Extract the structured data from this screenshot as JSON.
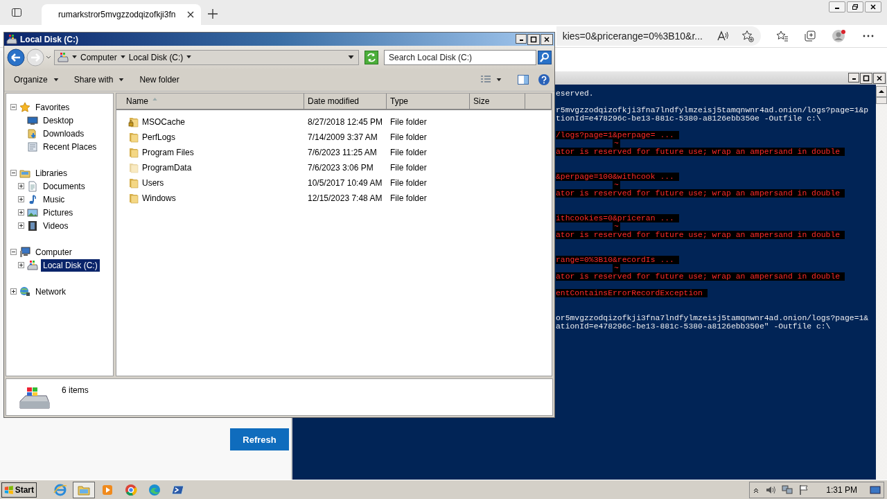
{
  "browser": {
    "tab_title": "rumarkstror5mvgzzodqizofkji3fn",
    "address": "kies=0&pricerange=0%3B10&r...",
    "page_button": "Refresh"
  },
  "console": {
    "lines": [
      {
        "kind": "output",
        "text": "eserved."
      },
      {
        "kind": "blank"
      },
      {
        "kind": "output",
        "text": "r5mvgzzodqizofkji3fna7lndfylmzeisj5tamqnwnr4ad.onion/logs?page=1&p"
      },
      {
        "kind": "output",
        "text": "tionId=e478296c-be13-881c-5380-a8126ebb350e -Outfile c:\\"
      },
      {
        "kind": "blank"
      },
      {
        "kind": "error",
        "text": "/logs?page=1&perpage= ..."
      },
      {
        "kind": "marker",
        "text": "~"
      },
      {
        "kind": "error",
        "text": "ator is reserved for future use; wrap an ampersand in double"
      },
      {
        "kind": "blank"
      },
      {
        "kind": "blank"
      },
      {
        "kind": "error",
        "text": "&perpage=100&withcook ..."
      },
      {
        "kind": "marker",
        "text": "~"
      },
      {
        "kind": "error",
        "text": "ator is reserved for future use; wrap an ampersand in double"
      },
      {
        "kind": "blank"
      },
      {
        "kind": "blank"
      },
      {
        "kind": "error",
        "text": "ithcookies=0&priceran ..."
      },
      {
        "kind": "marker",
        "text": "~"
      },
      {
        "kind": "error",
        "text": "ator is reserved for future use; wrap an ampersand in double"
      },
      {
        "kind": "blank"
      },
      {
        "kind": "blank"
      },
      {
        "kind": "error",
        "text": "range=0%3B10&recordIs ..."
      },
      {
        "kind": "marker",
        "text": "~"
      },
      {
        "kind": "error",
        "text": "ator is reserved for future use; wrap an ampersand in double"
      },
      {
        "kind": "blank"
      },
      {
        "kind": "error",
        "text": "entContainsErrorRecordException"
      },
      {
        "kind": "blank"
      },
      {
        "kind": "blank"
      },
      {
        "kind": "output",
        "text": "or5mvgzzodqizofkji3fna7lndfylmzeisj5tamqnwnr4ad.onion/logs?page=1&"
      },
      {
        "kind": "output",
        "text": "ationId=e478296c-be13-881c-5380-a8126ebb350e\" -Outfile c:\\"
      }
    ]
  },
  "explorer": {
    "title": "Local Disk (C:)",
    "breadcrumbs": [
      "Computer",
      "Local Disk (C:)"
    ],
    "search": {
      "placeholder": "Search Local Disk (C:)"
    },
    "toolbar": [
      {
        "label": "Organize",
        "menu": true
      },
      {
        "label": "Share with",
        "menu": true
      },
      {
        "label": "New folder",
        "menu": false
      }
    ],
    "tree": [
      {
        "label": "Favorites",
        "kind": "star",
        "expanded": true,
        "selected": false,
        "children": [
          {
            "label": "Desktop",
            "kind": "desktop",
            "selected": false
          },
          {
            "label": "Downloads",
            "kind": "downloads",
            "selected": false
          },
          {
            "label": "Recent Places",
            "kind": "recent",
            "selected": false
          }
        ]
      },
      {
        "label": "Libraries",
        "kind": "library",
        "expanded": true,
        "selected": false,
        "children": [
          {
            "label": "Documents",
            "kind": "document",
            "expanded": false,
            "selected": false
          },
          {
            "label": "Music",
            "kind": "music",
            "expanded": false,
            "selected": false
          },
          {
            "label": "Pictures",
            "kind": "pictures",
            "expanded": false,
            "selected": false
          },
          {
            "label": "Videos",
            "kind": "videos",
            "expanded": false,
            "selected": false
          }
        ]
      },
      {
        "label": "Computer",
        "kind": "computer",
        "expanded": true,
        "selected": false,
        "children": [
          {
            "label": "Local Disk (C:)",
            "kind": "drive",
            "expanded": false,
            "selected": true
          }
        ]
      },
      {
        "label": "Network",
        "kind": "network",
        "expanded": false,
        "selected": false
      }
    ],
    "columns": [
      {
        "label": "Name",
        "sorted": true
      },
      {
        "label": "Date modified",
        "sorted": false
      },
      {
        "label": "Type",
        "sorted": false
      },
      {
        "label": "Size",
        "sorted": false
      }
    ],
    "rows": [
      {
        "name": "MSOCache",
        "date": "8/27/2018 12:45 PM",
        "type": "File folder",
        "kind": "locked-folder",
        "hidden": false
      },
      {
        "name": "PerfLogs",
        "date": "7/14/2009 3:37 AM",
        "type": "File folder",
        "kind": "folder",
        "hidden": false
      },
      {
        "name": "Program Files",
        "date": "7/6/2023 11:25 AM",
        "type": "File folder",
        "kind": "folder",
        "hidden": false
      },
      {
        "name": "ProgramData",
        "date": "7/6/2023 3:06 PM",
        "type": "File folder",
        "kind": "folder",
        "hidden": true
      },
      {
        "name": "Users",
        "date": "10/5/2017 10:49 AM",
        "type": "File folder",
        "kind": "folder",
        "hidden": false
      },
      {
        "name": "Windows",
        "date": "12/15/2023 7:48 AM",
        "type": "File folder",
        "kind": "folder",
        "hidden": false
      }
    ],
    "status": "6 items"
  },
  "taskbar": {
    "start": "Start",
    "apps": [
      {
        "kind": "ie",
        "active": false
      },
      {
        "kind": "explorer",
        "active": true
      },
      {
        "kind": "media",
        "active": false
      },
      {
        "kind": "chrome",
        "active": false
      },
      {
        "kind": "edge",
        "active": false
      },
      {
        "kind": "powershell",
        "active": false
      }
    ],
    "clock": "1:31 PM"
  }
}
